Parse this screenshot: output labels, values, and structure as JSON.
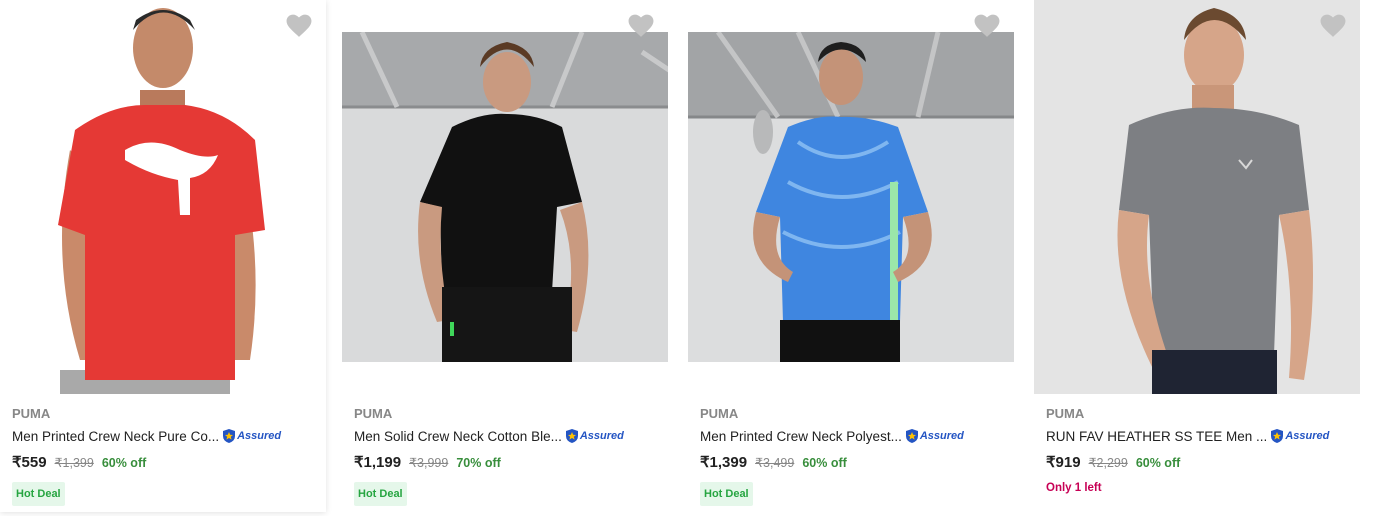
{
  "assured_label": "Assured",
  "colors": {
    "wishlist": "#c2c2c2",
    "discount": "#388e3c",
    "hot_deal_text": "#26a541",
    "hot_deal_bg": "#e5f7ea",
    "only_left": "#c70055",
    "assured": "#2455c3"
  },
  "products": [
    {
      "brand": "PUMA",
      "title": "Men Printed Crew Neck Pure Co...",
      "price": "₹559",
      "mrp": "₹1,399",
      "discount": "60% off",
      "badge": "Hot Deal",
      "image_icon": "red-tshirt-model-photo"
    },
    {
      "brand": "PUMA",
      "title": "Men Solid Crew Neck Cotton Ble...",
      "price": "₹1,199",
      "mrp": "₹3,999",
      "discount": "70% off",
      "badge": "Hot Deal",
      "image_icon": "black-tshirt-model-photo"
    },
    {
      "brand": "PUMA",
      "title": "Men Printed Crew Neck Polyest...",
      "price": "₹1,399",
      "mrp": "₹3,499",
      "discount": "60% off",
      "badge": "Hot Deal",
      "image_icon": "blue-tshirt-model-photo"
    },
    {
      "brand": "PUMA",
      "title": "RUN FAV HEATHER SS TEE Men ...",
      "price": "₹919",
      "mrp": "₹2,299",
      "discount": "60% off",
      "stock": "Only 1 left",
      "image_icon": "grey-tshirt-model-photo"
    }
  ]
}
